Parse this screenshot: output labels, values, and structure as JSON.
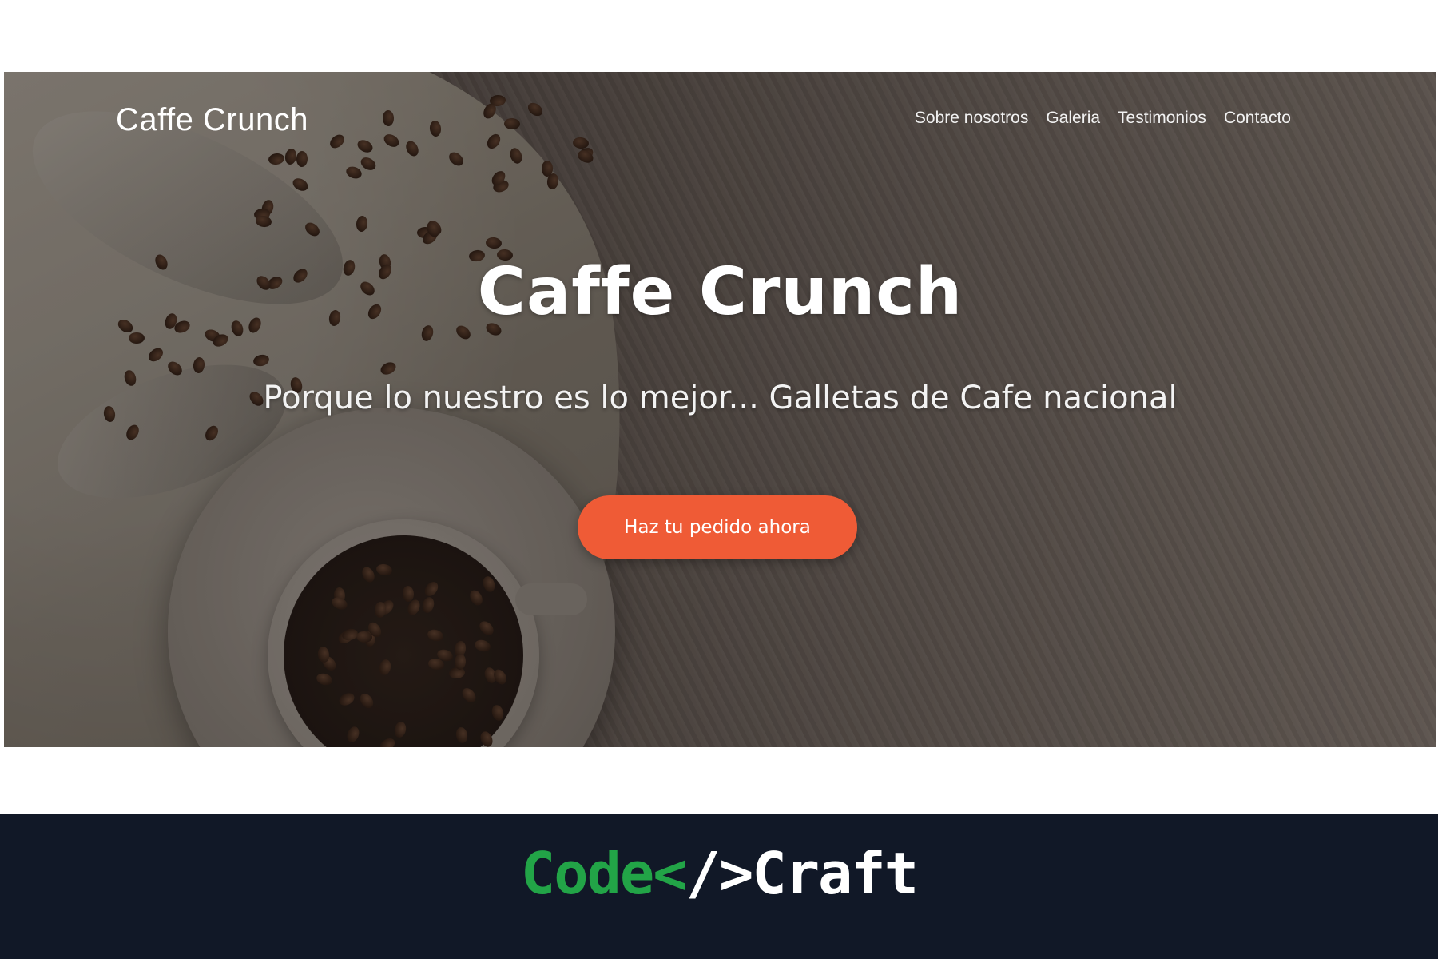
{
  "site": {
    "brand": "Caffe Crunch",
    "nav": [
      "Sobre nosotros",
      "Galeria",
      "Testimonios",
      "Contacto"
    ]
  },
  "hero": {
    "title": "Caffe Crunch",
    "subtitle": "Porque lo nuestro es lo mejor... Galletas de Cafe nacional",
    "cta": "Haz tu pedido ahora"
  },
  "footer": {
    "logo_code": "Code",
    "logo_lt": "<",
    "logo_slash": "/>",
    "logo_craft": "Craft"
  },
  "colors": {
    "cta": "#ef5b36",
    "footer_bg": "#111827",
    "logo_green": "#22a447"
  }
}
